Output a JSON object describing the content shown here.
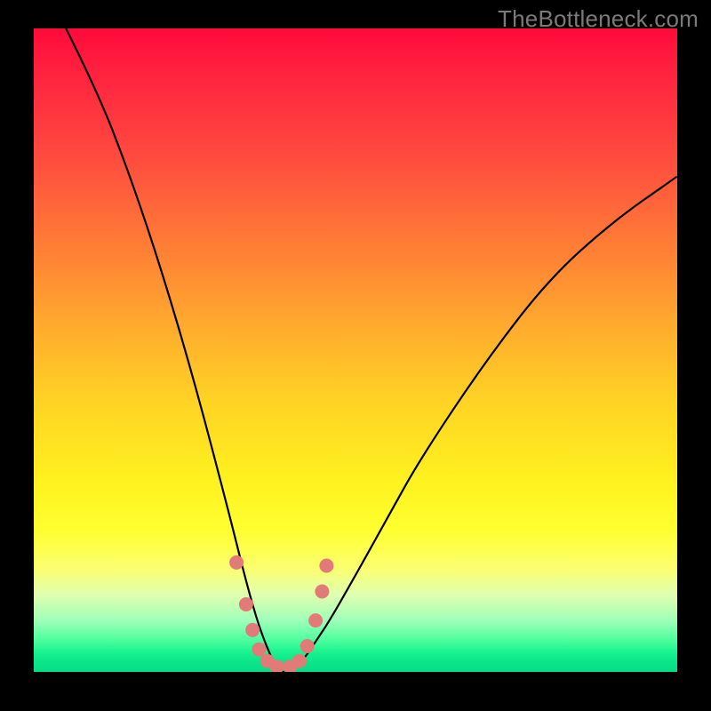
{
  "watermark": "TheBottleneck.com",
  "colors": {
    "frame": "#000000",
    "curve": "#000000",
    "marker": "#e27a77",
    "gradient_top": "#ff0a3a",
    "gradient_bottom": "#06dd86"
  },
  "chart_data": {
    "type": "line",
    "title": "",
    "xlabel": "",
    "ylabel": "",
    "xlim": [
      0,
      100
    ],
    "ylim": [
      0,
      100
    ],
    "note": "Axes unlabeled; x interpreted left→right 0–100, y interpreted bottom→top 0–100 (0 = green band, 100 = red top). Curve shows a V-shaped dip to ~0 near x≈38 and rises on both sides. Markers sit on the arms of the V near the bottom.",
    "series": [
      {
        "name": "bottleneck-curve",
        "x": [
          5,
          10,
          15,
          20,
          25,
          30,
          33,
          35,
          37,
          38,
          40,
          42,
          44,
          46,
          50,
          55,
          60,
          70,
          80,
          90,
          100
        ],
        "y": [
          100,
          90,
          77,
          62,
          45,
          26,
          14,
          7,
          2,
          0,
          0,
          2,
          5,
          8,
          15,
          24,
          33,
          48,
          61,
          70,
          77
        ]
      }
    ],
    "markers": {
      "name": "highlight-dots",
      "x": [
        31.5,
        33.0,
        34.0,
        35.0,
        36.3,
        37.8,
        39.8,
        41.3,
        42.5,
        43.8,
        44.8,
        45.5
      ],
      "y": [
        17.0,
        10.5,
        6.5,
        3.5,
        1.7,
        0.8,
        0.8,
        1.7,
        4.0,
        8.0,
        12.5,
        16.5
      ]
    }
  }
}
